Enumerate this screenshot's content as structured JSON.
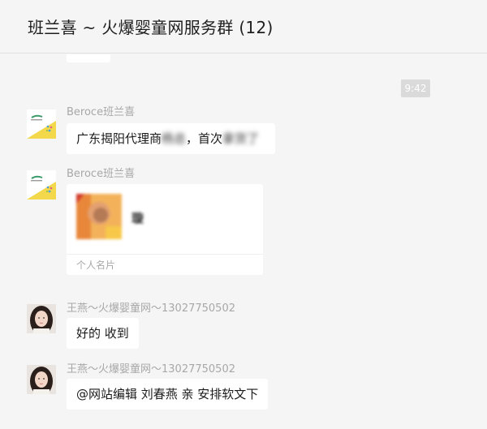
{
  "header": {
    "title": "班兰喜 ~ 火爆婴童网服务群 (12)"
  },
  "chat": {
    "timestamp": "9:42",
    "messages": [
      {
        "sender": "Beroce班兰喜",
        "text_visible": "广东揭阳代理商",
        "text_blurred_1": "杨总",
        "text_sep": "，首次",
        "text_blurred_2": "拿货了"
      },
      {
        "sender": "Beroce班兰喜",
        "card_name": "璇",
        "card_label": "个人名片"
      },
      {
        "sender": "王燕～火爆婴童网～13027750502",
        "text": "好的 收到"
      },
      {
        "sender": "王燕～火爆婴童网～13027750502",
        "text": "@网站编辑 刘春燕 亲 安排软文下"
      }
    ]
  },
  "colors": {
    "bubble": "#ffffff",
    "background": "#f5f5f5",
    "meta_text": "#a8a8a8",
    "timestamp_bg": "#dadada"
  }
}
